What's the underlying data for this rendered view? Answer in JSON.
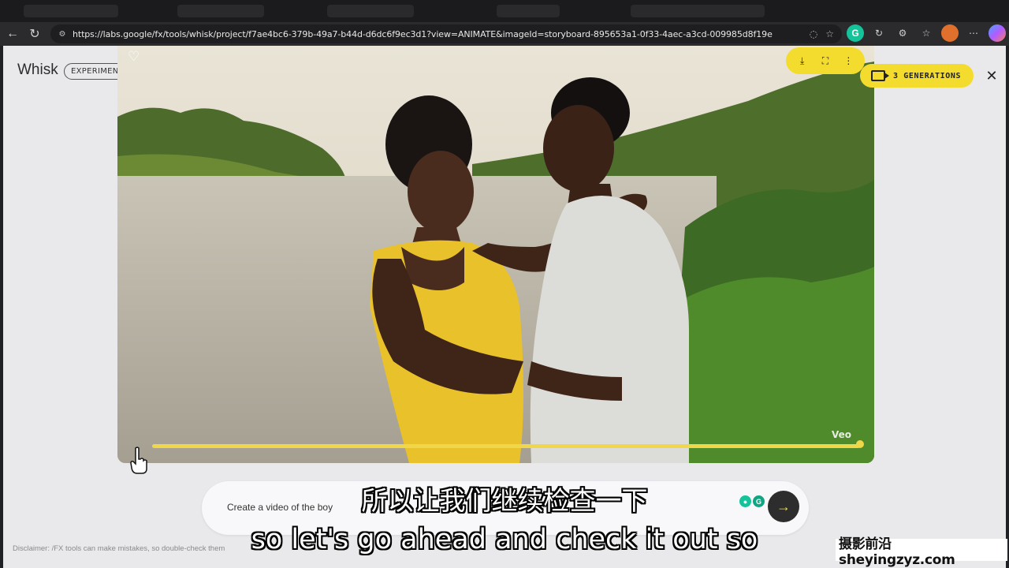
{
  "browser": {
    "url": "https://labs.google/fx/tools/whisk/project/f7ae4bc6-379b-49a7-b44d-d6dc6f9ec3d1?view=ANIMATE&imageId=storyboard-895653a1-0f33-4aec-a3cd-009985d8f19e",
    "icons": [
      "back-icon",
      "reload-icon",
      "site-info-icon",
      "eye-off-icon",
      "star-icon",
      "grammarly-icon",
      "extension-icon",
      "split-icon",
      "favorites-icon",
      "profile-icon",
      "more-icon",
      "copilot-icon"
    ]
  },
  "app": {
    "logo": "Whisk",
    "badge": "EXPERIMENT",
    "generations_label": "3 GENERATIONS",
    "accent_color": "#f3dc2e"
  },
  "video": {
    "watermark": "Veo",
    "progress": 1.0
  },
  "prompt": {
    "text": "Create a video of the boy",
    "send_icon": "arrow-right-icon"
  },
  "disclaimer": "Disclaimer: /FX tools can make mistakes, so double-check them",
  "subtitles": {
    "chinese": "所以让我们继续检查一下",
    "english": "so let's go ahead and check it out so"
  },
  "corner_watermark": "摄影前沿 sheyingzyz.com"
}
